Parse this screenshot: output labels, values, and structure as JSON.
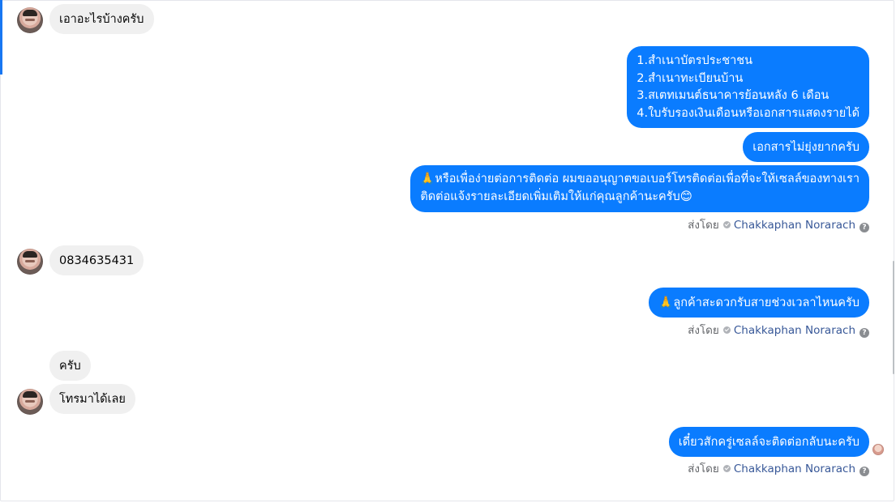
{
  "messages": {
    "m1": "เอาอะไรบ้างครับ",
    "m2_lines": "1.สำเนาบัตรประชาชน\n2.สำเนาทะเบียนบ้าน\n3.สเตทเมนต์ธนาคารย้อนหลัง 6 เดือน\n4.ใบรับรองเงินเดือนหรือเอกสารแสดงรายได้",
    "m3": "เอกสารไม่ยุ่งยากครับ",
    "m4": "🙏หรือเพื่อง่ายต่อการติดต่อ ผมขออนุญาตขอเบอร์โทรติดต่อเพื่อที่จะให้เซลล์ของทางเรา\nติดต่อแจ้งรายละเอียดเพิ่มเติมให้แก่คุณลูกค้านะครับ😊",
    "m5": "0834635431",
    "m6": "🙏ลูกค้าสะดวกรับสายช่วงเวลาไหนครับ",
    "m7": "ครับ",
    "m8": "โทรมาได้เลย",
    "m9": "เดี๋ยวสักครู่เซลล์จะติดต่อกลับนะครับ"
  },
  "sent_by": {
    "prefix": "ส่งโดย",
    "name": "Chakkaphan Norarach",
    "help": "?"
  },
  "colors": {
    "outgoing_bubble": "#0a7cff",
    "incoming_bubble": "#f0f0f0",
    "accent": "#1877f2"
  }
}
